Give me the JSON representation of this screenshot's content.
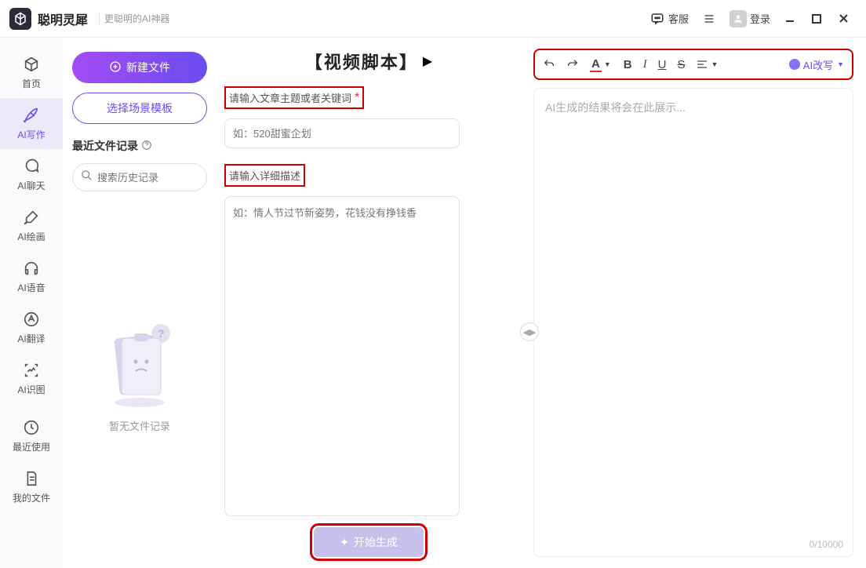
{
  "titlebar": {
    "appName": "聪明灵犀",
    "tagline": "更聪明的AI神器",
    "support": "客服",
    "login": "登录"
  },
  "nav": {
    "home": "首页",
    "write": "AI写作",
    "chat": "AI聊天",
    "paint": "AI绘画",
    "voice": "AI语音",
    "translate": "AI翻译",
    "vision": "AI识图",
    "recent": "最近使用",
    "files": "我的文件"
  },
  "filecol": {
    "newFile": "新建文件",
    "sceneTmpl": "选择场景模板",
    "recentHdr": "最近文件记录",
    "searchPh": "搜索历史记录",
    "empty": "暂无文件记录"
  },
  "center": {
    "title": "【视频脚本】",
    "label1": "请输入文章主题或者关键词",
    "topicPh": "如：520甜蜜企划",
    "label2": "请输入详细描述",
    "descPh": "如：情人节过节新姿势，花钱没有挣钱香",
    "generate": "开始生成"
  },
  "right": {
    "toolbar": {
      "fontLabel": "A",
      "bold": "B",
      "italic": "I",
      "underline": "U",
      "strike": "S",
      "rewrite": "AI改写"
    },
    "placeholder": "AI生成的结果将会在此展示...",
    "counter": "0/10000"
  }
}
